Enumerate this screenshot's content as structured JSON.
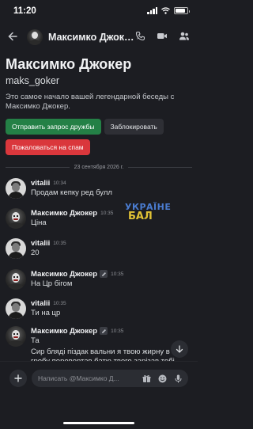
{
  "status_bar": {
    "time": "11:20",
    "battery_level": 0.85
  },
  "header": {
    "name": "Максимко Джок…",
    "actions": [
      "phone-icon",
      "video-icon",
      "people-icon"
    ]
  },
  "intro": {
    "name": "Максимко Джокер",
    "username": "maks_goker",
    "description": "Это самое начало вашей легендарной беседы с Максимко Джокер.",
    "buttons": {
      "friend_request": "Отправить запрос дружбы",
      "block": "Заблокировать",
      "report_spam": "Пожаловаться на спам"
    }
  },
  "date_divider": "23 сентября 2026 г.",
  "messages": [
    {
      "author": "vitalii",
      "time": "10:34",
      "text": "Продам кепку ред булл"
    },
    {
      "author": "Максимко Джокер",
      "time": "10:35",
      "text": "Ціна"
    },
    {
      "author": "vitalii",
      "time": "10:35",
      "text": "20"
    },
    {
      "author": "Максимко Джокер",
      "time": "10:35",
      "text": "На Цр бігом"
    },
    {
      "author": "vitalii",
      "time": "10:35",
      "text": "Ти на цр"
    },
    {
      "author": "Максимко Джокер",
      "time": "10:35",
      "text": "Та",
      "text2": "Сир бляді піздак вальни я твою жирну в гробу перевертав батю твого зарізав тобі очко роздер хуйло їбени син шлюхи дохлої"
    }
  ],
  "watermark": {
    "line1": "УКРАЇНЕ",
    "line2": "БАЛ"
  },
  "input": {
    "placeholder": "Написать @Максимко Д..."
  },
  "colors": {
    "background": "#1c1d22",
    "green_button": "#248046",
    "red_button": "#da373c"
  }
}
